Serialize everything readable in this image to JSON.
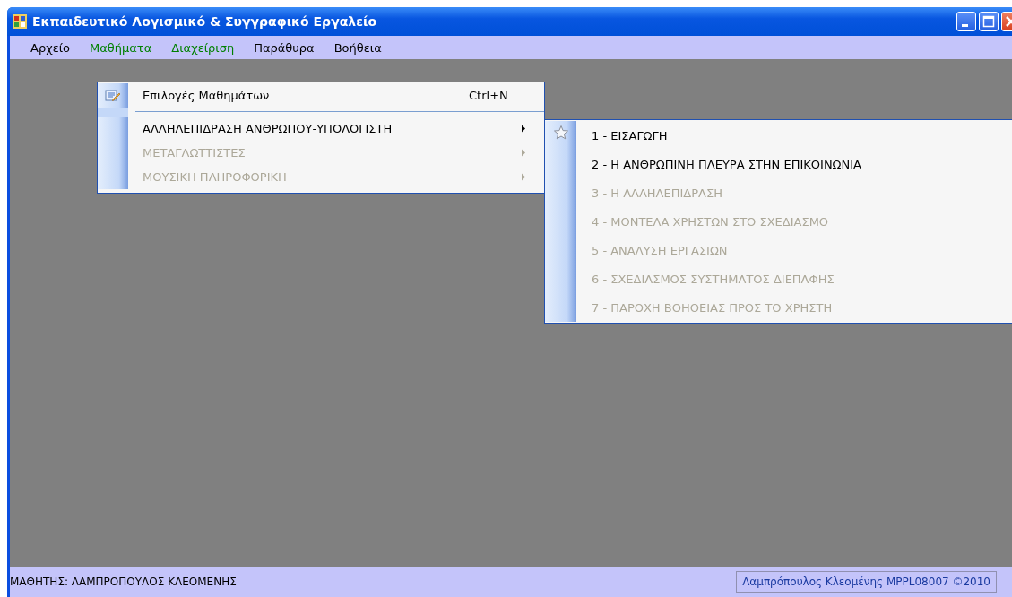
{
  "window": {
    "title": "Εκπαιδευτικό Λογισμικό & Συγγραφικό Εργαλείο"
  },
  "menu_bar": [
    {
      "label": "Αρχείο",
      "color": "#000000"
    },
    {
      "label": "Μαθήματα",
      "color": "#008000"
    },
    {
      "label": "Διαχείριση",
      "color": "#008000"
    },
    {
      "label": "Παράθυρα",
      "color": "#000000"
    },
    {
      "label": "Βοήθεια",
      "color": "#000000"
    }
  ],
  "dropdown": {
    "items": [
      {
        "kind": "command",
        "label": "Επιλογές Μαθημάτων",
        "shortcut": "Ctrl+N",
        "disabled": false
      },
      {
        "kind": "separator"
      },
      {
        "kind": "submenu",
        "label": "ΑΛΛΗΛΕΠΙΔΡΑΣΗ ΑΝΘΡΩΠΟΥ-ΥΠΟΛΟΓΙΣΤΗ",
        "disabled": false
      },
      {
        "kind": "submenu",
        "label": "ΜΕΤΑΓΛΩΤΤΙΣΤΕΣ",
        "disabled": true
      },
      {
        "kind": "submenu",
        "label": "ΜΟΥΣΙΚΗ ΠΛΗΡΟΦΟΡΙΚΗ",
        "disabled": true
      }
    ]
  },
  "submenu": {
    "items": [
      {
        "label": "1 - ΕΙΣΑΓΩΓΗ",
        "disabled": false
      },
      {
        "label": "2 - Η ΑΝΘΡΩΠΙΝΗ ΠΛΕΥΡΑ ΣΤΗΝ ΕΠΙΚΟΙΝΩΝΙΑ",
        "disabled": false
      },
      {
        "label": "3 - Η ΑΛΛΗΛΕΠΙΔΡΑΣΗ",
        "disabled": true
      },
      {
        "label": "4 - ΜΟΝΤΕΛΑ ΧΡΗΣΤΩΝ ΣΤΟ ΣΧΕΔΙΑΣΜΟ",
        "disabled": true
      },
      {
        "label": "5 - ΑΝΑΛΥΣΗ ΕΡΓΑΣΙΩΝ",
        "disabled": true
      },
      {
        "label": "6 - ΣΧΕΔΙΑΣΜΟΣ ΣΥΣΤΗΜΑΤΟΣ ΔΙΕΠΑΦΗΣ",
        "disabled": true
      },
      {
        "label": "7 - ΠΑΡΟΧΗ ΒΟΗΘΕΙΑΣ ΠΡΟΣ ΤΟ ΧΡΗΣΤΗ",
        "disabled": true
      }
    ]
  },
  "status_bar": {
    "left": "ΜΑΘΗΤΗΣ: ΛΑΜΠΡΟΠΟΥΛΟΣ ΚΛΕΟΜΕΝΗΣ",
    "right": "Λαμπρόπουλος Κλεομένης MPPL08007 ©2010"
  }
}
